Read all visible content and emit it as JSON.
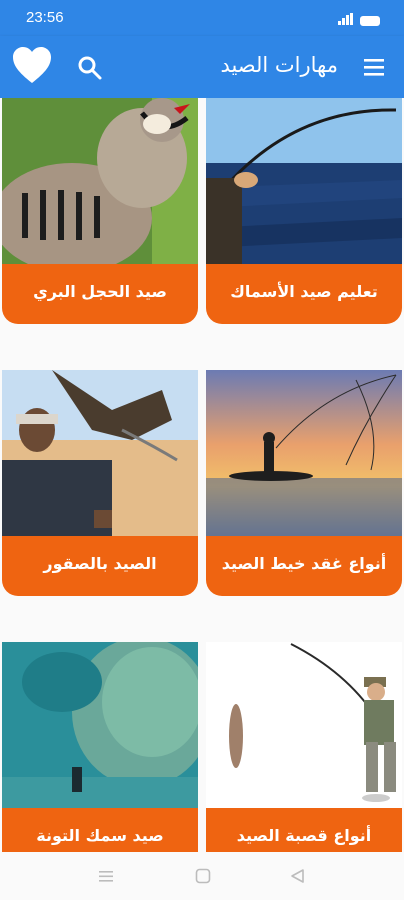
{
  "status_bar": {
    "time": "23:56"
  },
  "app_bar": {
    "title": "مهارات الصيد"
  },
  "cards": [
    {
      "label": "تعليم صيد الأسماك"
    },
    {
      "label": "صيد الحجل البري"
    },
    {
      "label": "أنواع غقد خيط الصيد"
    },
    {
      "label": "الصيد بالصقور"
    },
    {
      "label": "أنواع قصبة الصيد"
    },
    {
      "label": "صيد سمك التونة"
    }
  ],
  "colors": {
    "app_bar": "#2f86e6",
    "card_label": "#ef6411"
  },
  "icons": [
    "menu-icon",
    "search-icon",
    "heart-icon",
    "signal-icon",
    "battery-icon",
    "nav-menu-icon",
    "nav-home-icon",
    "nav-back-icon"
  ]
}
